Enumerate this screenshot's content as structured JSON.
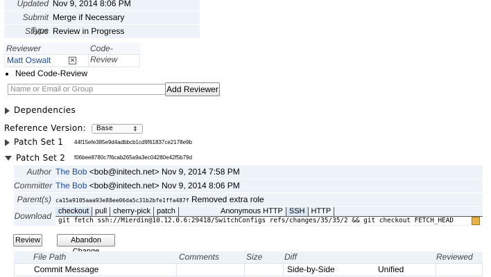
{
  "change_info": {
    "rows": [
      {
        "key": "Updated",
        "value": "Nov 9, 2014 8:06 PM"
      },
      {
        "key": "Submit Type",
        "value": "Merge if Necessary"
      },
      {
        "key": "Status",
        "value": "Review in Progress"
      }
    ]
  },
  "reviewers": {
    "col_reviewer": "Reviewer",
    "col_code_review": "Code-Review",
    "name": "Matt Oswalt",
    "remove_glyph": "✕",
    "need_label": "Need Code-Review",
    "input_placeholder": "Name or Email or Group",
    "add_button": "Add Reviewer"
  },
  "dependencies": {
    "label": "Dependencies"
  },
  "reference_version": {
    "label": "Reference Version:",
    "selected": "Base",
    "arrow": "⇕"
  },
  "patch_set_1": {
    "label": "Patch Set 1",
    "hash": "44f15efe385e9d4adbbcb1cd9f61837ce2178e9b"
  },
  "patch_set_2": {
    "label": "Patch Set 2",
    "hash": "f06bee8780c7f6cab265a9a3ec04280e42f5b79d"
  },
  "details": {
    "author_key": "Author",
    "author_name": "The Bob",
    "author_rest": "<bob@initech.net> Nov 9, 2014 7:58 PM",
    "committer_key": "Committer",
    "committer_name": "The Bob",
    "committer_rest": "<bob@initech.net> Nov 9, 2014 8:06 PM",
    "parent_key": "Parent(s)",
    "parent_hash": "ca15a9105aaa93e88ee06da5c31b2bfe1ffa487f",
    "parent_msg": "Removed extra role",
    "download_key": "Download",
    "tabs": [
      "checkout",
      "pull",
      "cherry-pick",
      "patch"
    ],
    "protocol_label": "Anonymous HTTP",
    "protocols": [
      "SSH",
      "HTTP"
    ],
    "command": "git fetch ssh://Mierdin@10.12.0.6:29418/SwitchConfigs refs/changes/35/35/2 && git checkout FETCH_HEAD"
  },
  "actions": {
    "review": "Review",
    "abandon": "Abandon Change"
  },
  "files": {
    "headers": [
      "File Path",
      "Comments",
      "Size",
      "Diff",
      "",
      "Reviewed"
    ],
    "rows": [
      {
        "path": "Commit Message",
        "comments": "",
        "size": "",
        "diff_a": "Side-by-Side",
        "diff_b": "Unified",
        "reviewed": ""
      }
    ]
  },
  "colors": {
    "link": "#1a4aa0",
    "panel": "#eef3f9"
  }
}
